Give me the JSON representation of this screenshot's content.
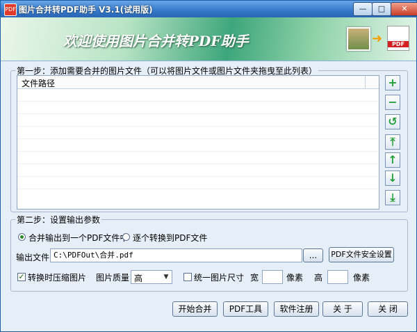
{
  "window": {
    "title": "图片合并转PDF助手 V3.1(试用版)",
    "minimize_glyph": "—",
    "maximize_glyph": "□",
    "close_glyph": "✕"
  },
  "banner": {
    "text": "欢迎使用图片合并转PDF助手",
    "pdf_badge": "PDF",
    "arrow_glyph": "➜"
  },
  "step1": {
    "legend": "第一步：添加需要合并的图片文件（可以将图片文件或图片文件夹拖曳至此列表）",
    "column_header": "文件路径",
    "side_buttons": [
      {
        "name": "add-file-button",
        "icon": "plus-icon",
        "glyph": "+"
      },
      {
        "name": "remove-file-button",
        "icon": "minus-icon",
        "glyph": "−"
      },
      {
        "name": "clear-list-button",
        "icon": "refresh-icon",
        "glyph": "↺"
      },
      {
        "name": "move-top-button",
        "icon": "move-top-icon",
        "glyph": "⤒"
      },
      {
        "name": "move-up-button",
        "icon": "arrow-up-icon",
        "glyph": "↑"
      },
      {
        "name": "move-down-button",
        "icon": "arrow-down-icon",
        "glyph": "↓"
      },
      {
        "name": "move-bottom-button",
        "icon": "move-bottom-icon",
        "glyph": "⤓"
      }
    ]
  },
  "step2": {
    "legend": "第二步：设置输出参数",
    "radio_merge": "合并输出到一个PDF文件中",
    "radio_each": "逐个转换到PDF文件",
    "output_label": "输出文件",
    "output_value": "C:\\PDFOut\\合并.pdf",
    "browse_label": "...",
    "security_label": "PDF文件安全设置",
    "compress_label": "转换时压缩图片",
    "quality_label": "图片质量",
    "quality_value": "高",
    "unify_label": "统一图片尺寸",
    "width_label": "宽",
    "width_unit": "像素",
    "height_label": "高",
    "height_unit": "像素"
  },
  "footer": {
    "start": "开始合并",
    "pdf_tools": "PDF工具",
    "register": "软件注册",
    "about": "关 于",
    "close": "关 闭"
  },
  "colors": {
    "accent_green": "#24a03a",
    "title_blue": "#3578c9"
  }
}
